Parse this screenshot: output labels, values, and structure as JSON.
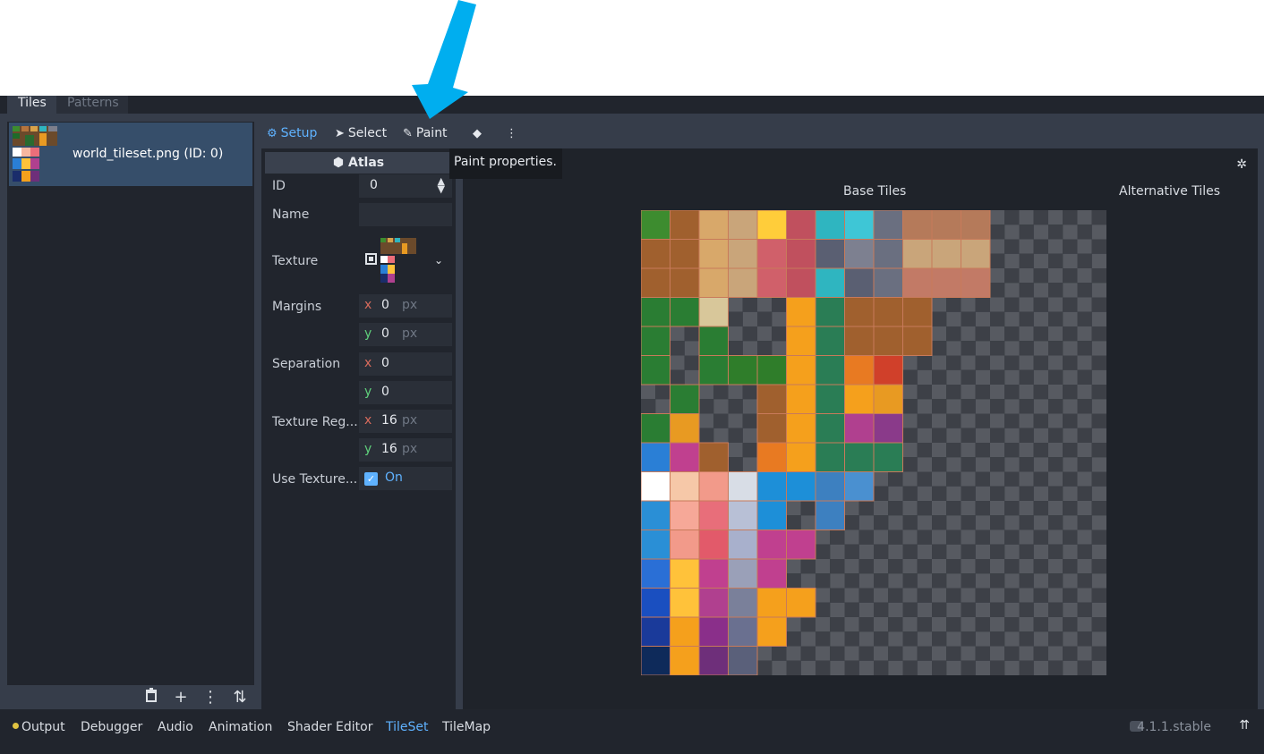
{
  "tabs": [
    {
      "label": "Tiles",
      "active": true
    },
    {
      "label": "Patterns",
      "active": false
    }
  ],
  "sources": [
    {
      "label": "world_tileset.png (ID: 0)"
    }
  ],
  "left_bottom_icons": [
    "trash-icon",
    "plus-icon",
    "kebab-menu-icon",
    "sort-icon"
  ],
  "toolbar": {
    "setup_label": "Setup",
    "select_label": "Select",
    "paint_label": "Paint",
    "active": "Setup"
  },
  "tooltip": "Paint properties.",
  "inspector": {
    "header": "Atlas",
    "id_label": "ID",
    "id_value": "0",
    "name_label": "Name",
    "name_value": "",
    "texture_label": "Texture",
    "margins_label": "Margins",
    "margins_x": "0",
    "margins_y": "0",
    "separation_label": "Separation",
    "separation_x": "0",
    "separation_y": "0",
    "region_label": "Texture Reg...",
    "region_x": "16",
    "region_y": "16",
    "use_texture_label": "Use Texture...",
    "use_texture_value": "On",
    "axis_x": "x",
    "axis_y": "y",
    "unit_px": "px"
  },
  "atlas_view": {
    "base_title": "Base Tiles",
    "alt_title": "Alternative Tiles"
  },
  "bottom_panels": [
    {
      "label": "Output",
      "active": false
    },
    {
      "label": "Debugger",
      "active": false
    },
    {
      "label": "Audio",
      "active": false
    },
    {
      "label": "Animation",
      "active": false
    },
    {
      "label": "Shader Editor",
      "active": false
    },
    {
      "label": "TileSet",
      "active": true
    },
    {
      "label": "TileMap",
      "active": false
    }
  ],
  "version": "4.1.1.stable",
  "colors": {
    "accent": "#5fb2ff",
    "arrow": "#00aeef",
    "panel": "#363d4a",
    "background": "#21252d"
  }
}
